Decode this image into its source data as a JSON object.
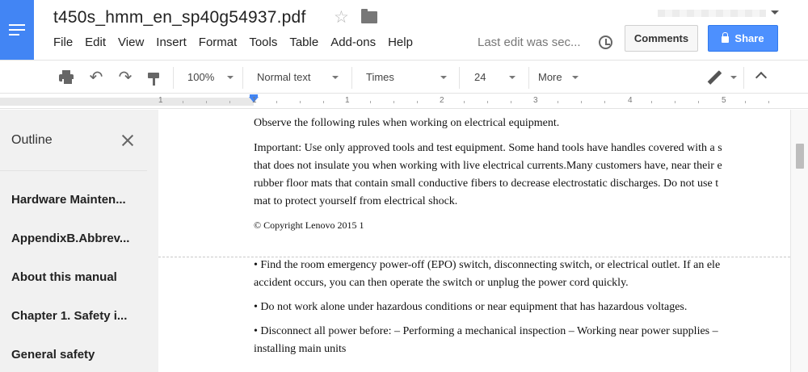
{
  "header": {
    "doc_title": "t450s_hmm_en_sp40g54937.pdf",
    "menu": [
      "File",
      "Edit",
      "View",
      "Insert",
      "Format",
      "Tools",
      "Table",
      "Add-ons",
      "Help"
    ],
    "last_edit": "Last edit was sec...",
    "comments_label": "Comments",
    "share_label": "Share"
  },
  "toolbar": {
    "zoom": "100%",
    "style": "Normal text",
    "font": "Times",
    "size": "24",
    "more": "More"
  },
  "ruler": {
    "numbers": [
      "1",
      "1",
      "1",
      "2",
      "3",
      "4",
      "5"
    ]
  },
  "outline": {
    "title": "Outline",
    "items": [
      "Hardware Mainten...",
      "AppendixB.Abbrev...",
      "About this manual",
      "Chapter 1. Safety i...",
      "General safety"
    ]
  },
  "document": {
    "lines_top": [
      "Observe the following rules when working on electrical equipment.",
      "Important: Use only approved tools and test equipment. Some hand tools have handles covered with a s",
      "that does not insulate you when working with live electrical currents.Many customers have, near their e",
      "rubber floor mats that contain small conductive fibers to decrease electrostatic discharges. Do not use t",
      "mat to protect yourself from electrical shock."
    ],
    "copyright": "© Copyright Lenovo 2015 1",
    "lines_bottom": [
      "• Find the room emergency power-off (EPO) switch, disconnecting switch, or electrical outlet. If an ele",
      "accident occurs, you can then operate the switch or unplug the power cord quickly.",
      "• Do not work alone under hazardous conditions or near equipment that has hazardous voltages.",
      "• Disconnect all power before: – Performing a mechanical inspection – Working near power supplies –",
      "installing main units"
    ]
  },
  "icons": {
    "app": "docs-menu-icon",
    "star": "star-icon",
    "folder": "folder-icon",
    "history": "history-icon",
    "print": "printer-icon",
    "undo": "undo-icon",
    "redo": "redo-icon",
    "paint": "paint-format-icon",
    "edit_mode": "pencil-icon",
    "collapse": "chevron-up-icon",
    "close": "close-icon",
    "lock": "lock-icon"
  },
  "colors": {
    "brand": "#4285f4",
    "share": "#4d90fe"
  }
}
